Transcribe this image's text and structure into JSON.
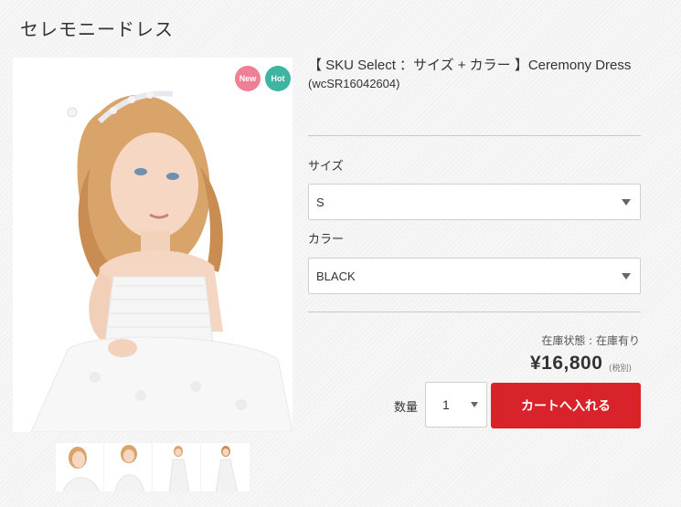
{
  "page": {
    "title": "セレモニードレス"
  },
  "badges": {
    "new": "New",
    "hot": "Hot"
  },
  "product": {
    "name": "【 SKU Select ：サイズ + カラー 】Ceremony Dress",
    "code": "(wcSR16042604)"
  },
  "options": {
    "size": {
      "label": "サイズ",
      "selected": "S"
    },
    "color": {
      "label": "カラー",
      "selected": "BLACK"
    }
  },
  "stock": {
    "status": "在庫状態 : 在庫有り"
  },
  "price": {
    "amount": "¥16,800",
    "tax_note": "(税別)"
  },
  "quantity": {
    "label": "数量",
    "value": "1"
  },
  "cart": {
    "button_label": "カートへ入れる"
  },
  "colors": {
    "accent": "#d8232a",
    "badge_new": "#ee7f95",
    "badge_hot": "#3fb4a2"
  }
}
